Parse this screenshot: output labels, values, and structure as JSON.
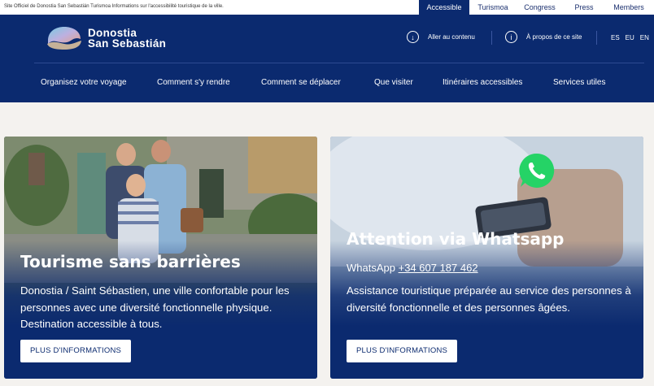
{
  "topbar": {
    "official_text": "Site Officiel de Donostia San Sebastián Turismoa Informations sur l'accessibilité touristique de la ville.",
    "links": [
      {
        "label": "Accessible",
        "active": true
      },
      {
        "label": "Turismoa",
        "active": false
      },
      {
        "label": "Congress",
        "active": false
      },
      {
        "label": "Press",
        "active": false
      },
      {
        "label": "Members",
        "active": false
      }
    ]
  },
  "header": {
    "logo_line1": "Donostia",
    "logo_line2": "San Sebastián",
    "skip_link": "Aller au contenu",
    "about_link": "À propos de ce site",
    "languages": [
      "ES",
      "EU",
      "EN"
    ]
  },
  "nav": {
    "items": [
      "Organisez votre voyage",
      "Comment s'y rendre",
      "Comment se déplacer",
      "Que visiter",
      "Itinéraires accessibles",
      "Services utiles"
    ]
  },
  "cards": [
    {
      "title": "Tourisme sans barrières",
      "text": "Donostia / Saint Sébastien, une ville confortable pour les personnes avec une diversité fonctionnelle physique. Destination accessible à tous.",
      "button": "PLUS D'INFORMATIONS"
    },
    {
      "title": "Attention via Whatsapp",
      "phone_prefix": "WhatsApp",
      "phone_number": "+34 607 187 462",
      "text": "Assistance touristique préparée au service des personnes à diversité fonctionnelle et des personnes âgées.",
      "button": "PLUS D'INFORMATIONS"
    }
  ],
  "colors": {
    "brand_blue": "#0b2a6f",
    "whatsapp_green": "#25d366",
    "page_bg": "#f4f2ef"
  }
}
